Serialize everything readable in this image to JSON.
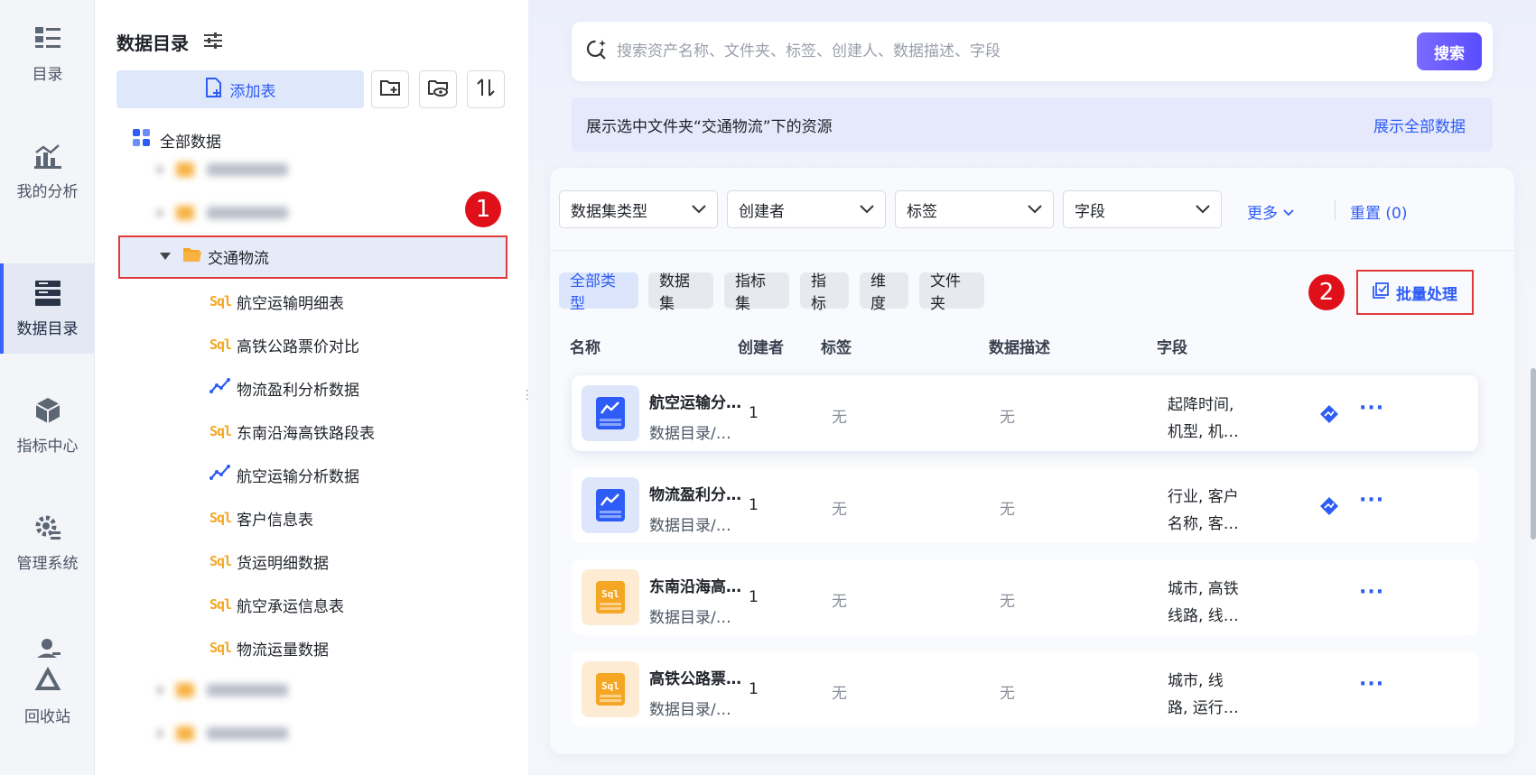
{
  "nav": {
    "items": [
      {
        "label": "目录",
        "icon": "catalog-list-icon"
      },
      {
        "label": "我的分析",
        "icon": "analysis-chart-icon"
      },
      {
        "label": "数据目录",
        "icon": "data-catalog-icon"
      },
      {
        "label": "指标中心",
        "icon": "metric-cube-icon"
      },
      {
        "label": "管理系统",
        "icon": "admin-gear-icon"
      },
      {
        "label": "回收站",
        "icon": "recycle-bin-icon"
      }
    ],
    "active": "数据目录"
  },
  "tree": {
    "title": "数据目录",
    "add_table": "添加表",
    "all_data": "全部数据",
    "selected_folder": "交通物流",
    "children": [
      {
        "type": "sql",
        "label": "航空运输明细表"
      },
      {
        "type": "sql",
        "label": "高铁公路票价对比"
      },
      {
        "type": "analysis",
        "label": "物流盈利分析数据"
      },
      {
        "type": "sql",
        "label": "东南沿海高铁路段表"
      },
      {
        "type": "analysis",
        "label": "航空运输分析数据"
      },
      {
        "type": "sql",
        "label": "客户信息表"
      },
      {
        "type": "sql",
        "label": "货运明细数据"
      },
      {
        "type": "sql",
        "label": "航空承运信息表"
      },
      {
        "type": "sql",
        "label": "物流运量数据"
      }
    ],
    "sql_glyph": "Sql"
  },
  "annotations": {
    "one": "1",
    "two": "2"
  },
  "search": {
    "placeholder": "搜索资产名称、文件夹、标签、创建人、数据描述、字段",
    "button": "搜索"
  },
  "banner": {
    "text": "展示选中文件夹“交通物流”下的资源",
    "show_all": "展示全部数据"
  },
  "filters": {
    "dataset_type": "数据集类型",
    "creator": "创建者",
    "tag": "标签",
    "field": "字段",
    "more": "更多",
    "reset": "重置 (0)"
  },
  "chips": [
    "全部类型",
    "数据集",
    "指标集",
    "指标",
    "维度",
    "文件夹"
  ],
  "batch": "批量处理",
  "columns": {
    "name": "名称",
    "creator": "创建者",
    "tag": "标签",
    "desc": "数据描述",
    "field": "字段"
  },
  "rows": [
    {
      "kind": "analysis",
      "name": "航空运输分…",
      "path": "数据目录/…",
      "creator": "1",
      "tag": "无",
      "desc": "无",
      "field1": "起降时间,",
      "field2": "机型, 机…"
    },
    {
      "kind": "analysis",
      "name": "物流盈利分…",
      "path": "数据目录/…",
      "creator": "1",
      "tag": "无",
      "desc": "无",
      "field1": "行业, 客户",
      "field2": "名称, 客…"
    },
    {
      "kind": "sql",
      "name": "东南沿海高…",
      "path": "数据目录/…",
      "creator": "1",
      "tag": "无",
      "desc": "无",
      "field1": "城市, 高铁",
      "field2": "线路, 线…"
    },
    {
      "kind": "sql",
      "name": "高铁公路票…",
      "path": "数据目录/…",
      "creator": "1",
      "tag": "无",
      "desc": "无",
      "field1": "城市, 线",
      "field2": "路, 运行…"
    }
  ],
  "more_glyph": "···",
  "colors": {
    "accent": "#2d5cf6",
    "annotation_red": "#e0101a",
    "sql_orange": "#f5a623"
  }
}
